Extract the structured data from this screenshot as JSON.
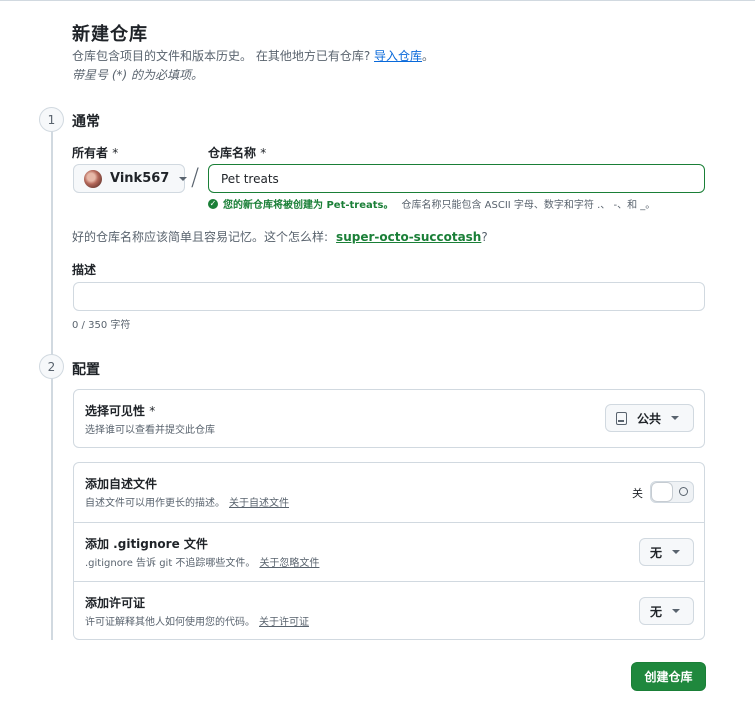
{
  "header": {
    "title": "新建仓库",
    "subtitle_text": "仓库包含项目的文件和版本历史。 在其他地方已有仓库?",
    "import_link": "导入仓库",
    "subtitle_end": "。",
    "required_note": "带星号 (*) 的为必填项。"
  },
  "section_general": {
    "step": "1",
    "title": "通常",
    "owner_label": "所有者",
    "owner_required": "*",
    "owner_value": "Vink567",
    "separator": "/",
    "repo_name_label": "仓库名称",
    "repo_name_required": "*",
    "repo_name_value": "Pet treats",
    "validation_success": "您的新仓库将被创建为 Pet-treats。",
    "validation_hint": "仓库名称只能包含 ASCII 字母、数字和字符 .、 -、和 _。",
    "suggestion_text": "好的仓库名称应该简单且容易记忆。这个怎么样:",
    "suggestion_name": "super-octo-succotash",
    "suggestion_end": "?",
    "description_label": "描述",
    "description_value": "",
    "char_count": "0 / 350 字符"
  },
  "section_config": {
    "step": "2",
    "title": "配置",
    "visibility_title": "选择可见性",
    "visibility_required": "*",
    "visibility_desc": "选择谁可以查看并提交此仓库",
    "visibility_value": "公共",
    "readme_title": "添加自述文件",
    "readme_desc": "自述文件可以用作更长的描述。",
    "readme_link": "关于自述文件",
    "readme_toggle_label": "关",
    "readme_enabled": false,
    "gitignore_title": "添加 .gitignore 文件",
    "gitignore_desc": ".gitignore 告诉 git 不追踪哪些文件。",
    "gitignore_link": "关于忽略文件",
    "gitignore_value": "无",
    "license_title": "添加许可证",
    "license_desc": "许可证解释其他人如何使用您的代码。",
    "license_link": "关于许可证",
    "license_value": "无"
  },
  "actions": {
    "create_button": "创建仓库"
  },
  "colors": {
    "primary_green": "#1f883d",
    "success_text": "#1a7f37",
    "link_blue": "#0969da",
    "border": "#d1d9e0",
    "muted_text": "#59636e"
  }
}
